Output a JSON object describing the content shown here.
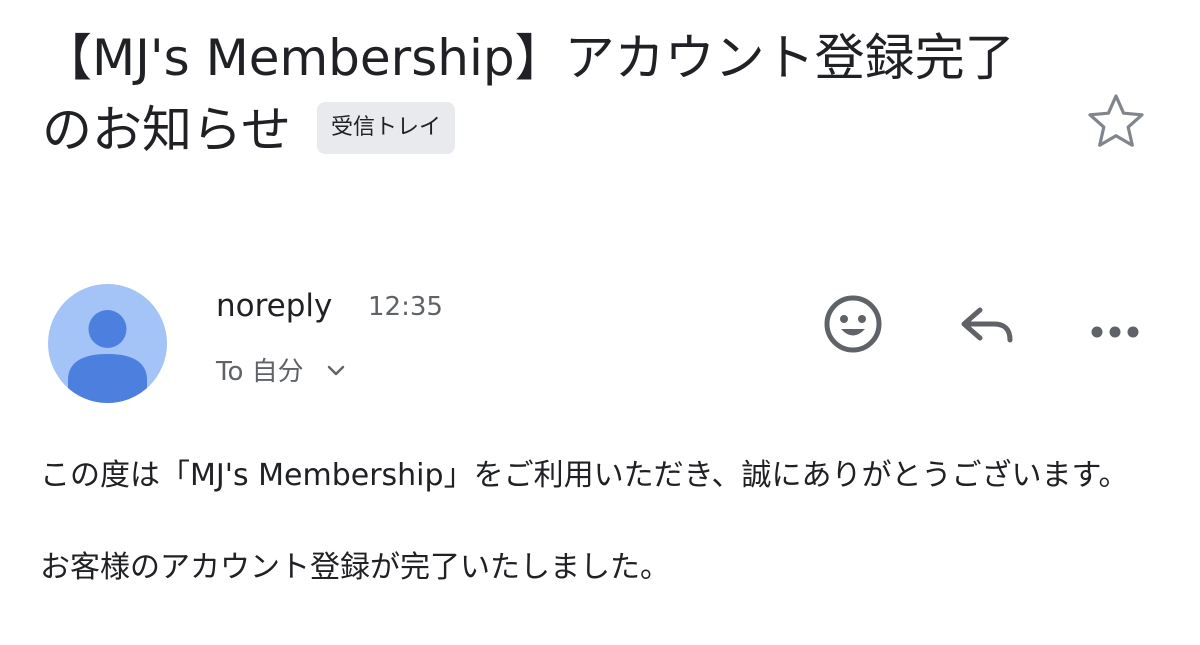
{
  "email": {
    "subject": "【MJ's Membership】アカウント登録完了のお知らせ",
    "label": "受信トレイ",
    "sender": {
      "name": "noreply",
      "time": "12:35",
      "recipient": "To 自分"
    },
    "body": {
      "paragraph1": "この度は「MJ's Membership」をご利用いただき、誠にありがとうございます。",
      "paragraph2": "お客様のアカウント登録が完了いたしました。"
    }
  },
  "icons": {
    "star": "star-outline-icon",
    "avatar": "person-avatar-icon",
    "emoji": "emoji-reaction-icon",
    "reply": "reply-arrow-icon",
    "more": "more-horizontal-icon",
    "expand": "chevron-down-icon"
  },
  "colors": {
    "avatar_bg": "#a4c3f6",
    "avatar_fg": "#4d7fdf",
    "chip_bg": "#e8eaed",
    "icon_gray": "#5f6368"
  }
}
